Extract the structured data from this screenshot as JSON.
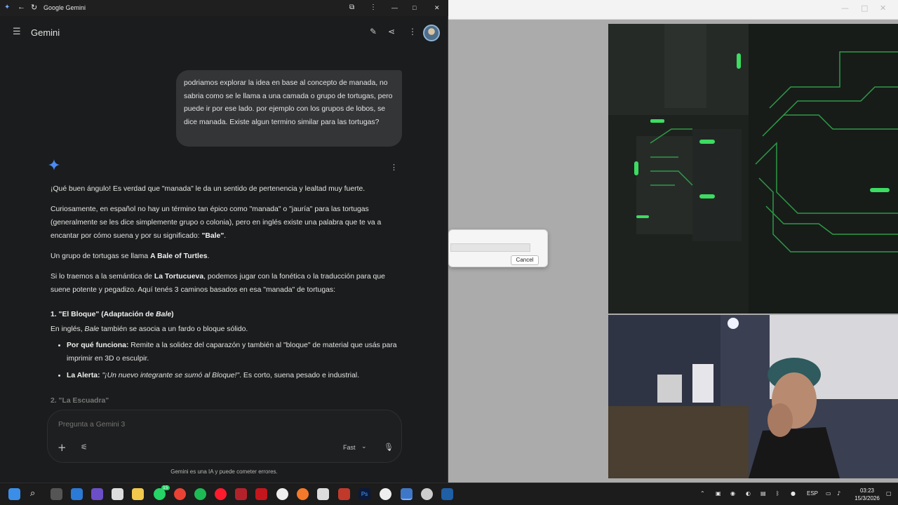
{
  "window": {
    "title": "Google Gemini"
  },
  "header": {
    "title": "Gemini"
  },
  "user_message": "podriamos explorar la idea en base al concepto de manada, no sabria como se le llama a una camada o grupo de tortugas, pero puede ir por ese lado. por ejemplo con los grupos de lobos, se dice manada. Existe algun termino similar para las tortugas?",
  "response": {
    "p1": "¡Qué buen ángulo! Es verdad que \"manada\" le da un sentido de pertenencia y lealtad muy fuerte.",
    "p2_text": "Curiosamente, en español no hay un término tan épico como \"manada\" o \"jauría\" para las tortugas (generalmente se les dice simplemente grupo o colonia), pero en inglés existe una palabra que te va a encantar por cómo suena y por su significado: ",
    "p2_bold": "\"Bale\"",
    "p2_end": ".",
    "p3_text": "Un grupo de tortugas se llama ",
    "p3_bold": "A Bale of Turtles",
    "p3_end": ".",
    "p4_text": "Si lo traemos a la semántica de ",
    "p4_bold": "La Tortucueva",
    "p4_end": ", podemos jugar con la fonética o la traducción para que suene potente y pegadizo. Aquí tenés 3 caminos basados en esa \"manada\" de tortugas:",
    "h1_text": "1. \"El Bloque\" (Adaptación de ",
    "h1_italic": "Bale",
    "h1_end": ")",
    "s1_text": "En inglés, ",
    "s1_italic": "Bale",
    "s1_end": " también se asocia a un fardo o bloque sólido.",
    "b1_label": "Por qué funciona:",
    "b1_text": " Remite a la solidez del caparazón y también al \"bloque\" de material que usás para imprimir en 3D o esculpir.",
    "b2_label": "La Alerta:",
    "b2_italic": "\"¡Un nuevo integrante se sumó al Bloque!\"",
    "b2_text": ". Es corto, suena pesado e industrial.",
    "h2": "2. \"La Escuadra\""
  },
  "input": {
    "placeholder": "Pregunta a Gemini 3",
    "mode": "Fast"
  },
  "disclaimer": "Gemini es una IA y puede cometer errores.",
  "dialog": {
    "cancel_label": "Cancel"
  },
  "taskbar": {
    "lang": "ESP",
    "time": "03:23",
    "date": "15/3/2026",
    "badge": "15"
  },
  "colors": {
    "accent": "#4285f4",
    "bubble": "#333537",
    "background": "#1b1c1d"
  }
}
